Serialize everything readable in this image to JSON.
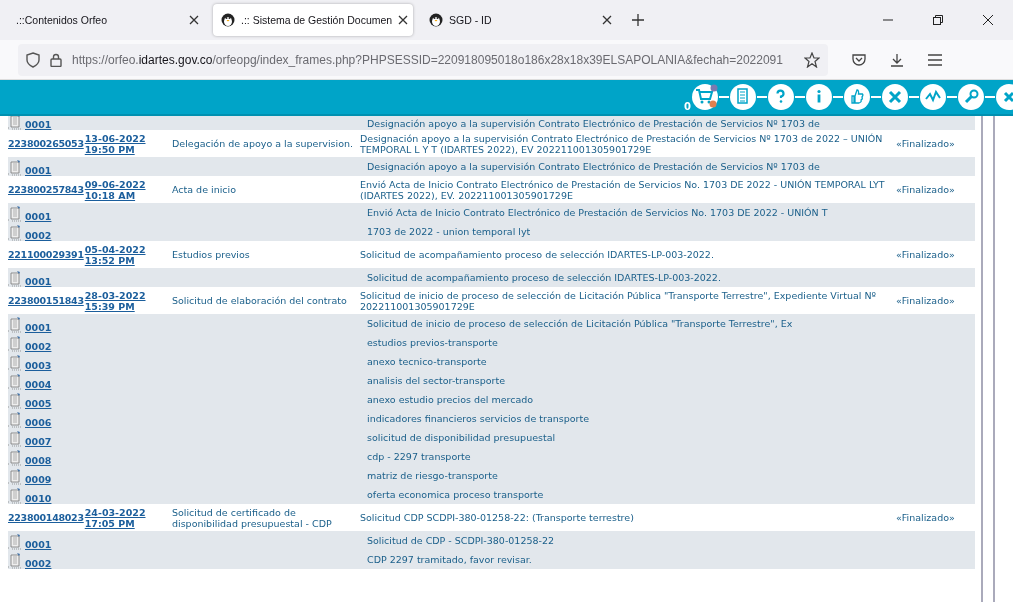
{
  "browser": {
    "tabs": [
      {
        "title": ".::Contenidos Orfeo",
        "selected": false,
        "icon": false
      },
      {
        "title": ".:: Sistema de Gestión Documen",
        "selected": true,
        "icon": true
      },
      {
        "title": "SGD - ID",
        "selected": false,
        "icon": true
      }
    ],
    "url_parts": [
      "https://orfeo.",
      "idartes.gov.co",
      "/orfeopg/index_frames.php?PHPSESSID=220918095018o186x28x18x39ELSAPOLANIA&fechah=2022091"
    ]
  },
  "toolbar": {
    "cart_count": "0"
  },
  "rows": [
    {
      "kind": "annex",
      "number": "0001",
      "description": "Designación apoyo a la supervisión Contrato Electrónico de Prestación de Servicios Nº 1703 de"
    },
    {
      "kind": "record",
      "number": "223800265053",
      "date": "13-06-2022",
      "time": "19:50 PM",
      "subject": "Delegación de apoyo a la supervision.",
      "description": "Designación apoyo a la supervisión Contrato Electrónico de Prestación de Servicios Nº 1703 de 2022 – UNIÓN TEMPORAL L Y T (IDARTES 2022), EV 202211001305901729E",
      "status": "«Finalizado»"
    },
    {
      "kind": "annex",
      "number": "0001",
      "description": "Designación apoyo a la supervisión Contrato Electrónico de Prestación de Servicios Nº 1703 de"
    },
    {
      "kind": "record",
      "number": "223800257843",
      "date": "09-06-2022",
      "time": "10:18 AM",
      "subject": "Acta de inicio",
      "description": "Envió Acta de Inicio Contrato Electrónico de Prestación de Servicios No. 1703 DE 2022 - UNIÓN TEMPORAL LYT (IDARTES 2022), EV. 202211001305901729E",
      "status": "«Finalizado»"
    },
    {
      "kind": "annex",
      "number": "0001",
      "description": "Envió Acta de Inicio Contrato Electrónico de Prestación de Servicios No. 1703 DE 2022 - UNIÓN T"
    },
    {
      "kind": "annex",
      "number": "0002",
      "description": "1703 de 2022 - union temporal lyt"
    },
    {
      "kind": "record",
      "number": "221100029391",
      "date": "05-04-2022",
      "time": "13:52 PM",
      "subject": "Estudios previos",
      "description": "Solicitud de acompañamiento proceso de selección IDARTES-LP-003-2022.",
      "status": "«Finalizado»"
    },
    {
      "kind": "annex",
      "number": "0001",
      "description": "Solicitud de acompañamiento proceso de selección IDARTES-LP-003-2022."
    },
    {
      "kind": "record",
      "number": "223800151843",
      "date": "28-03-2022",
      "time": "15:39 PM",
      "subject": "Solicitud de elaboración del contrato",
      "description": "Solicitud de inicio de proceso de selección de Licitación Pública \"Transporte Terrestre\", Expediente Virtual Nº 202211001305901729E",
      "status": "«Finalizado»"
    },
    {
      "kind": "annex",
      "number": "0001",
      "description": "Solicitud de inicio de proceso de selección de Licitación Pública \"Transporte Terrestre\", Ex"
    },
    {
      "kind": "annex",
      "number": "0002",
      "description": "estudios previos-transporte"
    },
    {
      "kind": "annex",
      "number": "0003",
      "description": "anexo tecnico-transporte"
    },
    {
      "kind": "annex",
      "number": "0004",
      "description": "analisis del sector-transporte"
    },
    {
      "kind": "annex",
      "number": "0005",
      "description": "anexo estudio precios del mercado"
    },
    {
      "kind": "annex",
      "number": "0006",
      "description": "indicadores financieros servicios de transporte"
    },
    {
      "kind": "annex",
      "number": "0007",
      "description": "solicitud de disponibilidad presupuestal"
    },
    {
      "kind": "annex",
      "number": "0008",
      "description": "cdp - 2297 transporte"
    },
    {
      "kind": "annex",
      "number": "0009",
      "description": "matriz de riesgo-transporte"
    },
    {
      "kind": "annex",
      "number": "0010",
      "description": "oferta economica proceso transporte"
    },
    {
      "kind": "record",
      "number": "223800148023",
      "date": "24-03-2022",
      "time": "17:05 PM",
      "subject": "Solicitud de certificado de disponibilidad presupuestal - CDP",
      "description": "Solicitud CDP SCDPI-380-01258-22: (Transporte terrestre)",
      "status": "«Finalizado»"
    },
    {
      "kind": "annex",
      "number": "0001",
      "description": "Solicitud de CDP - SCDPI-380-01258-22"
    },
    {
      "kind": "annex",
      "number": "0002",
      "description": "CDP 2297 tramitado, favor revisar."
    }
  ]
}
